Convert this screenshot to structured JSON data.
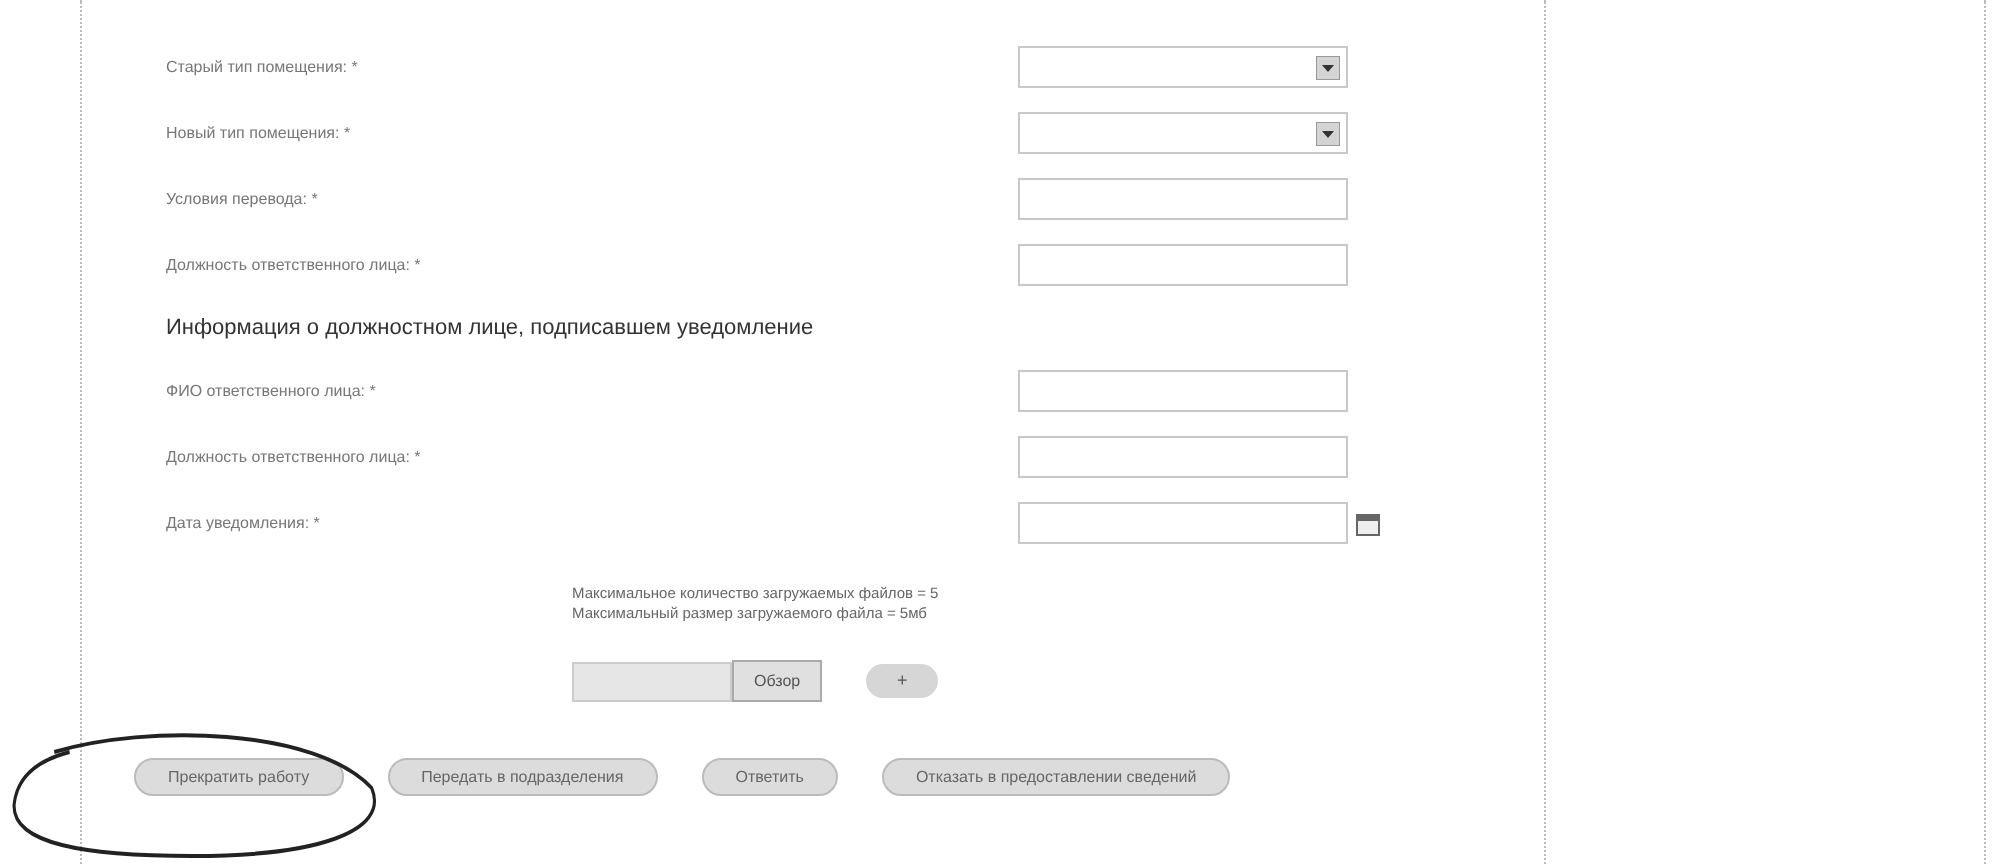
{
  "fields_top": [
    {
      "label": "Старый тип помещения: *",
      "kind": "select"
    },
    {
      "label": "Новый тип помещения: *",
      "kind": "select"
    },
    {
      "label": "Условия перевода: *",
      "kind": "text"
    },
    {
      "label": "Должность ответственного лица: *",
      "kind": "text"
    }
  ],
  "section_heading": "Информация о должностном лице, подписавшем уведомление",
  "fields_bottom": [
    {
      "label": "ФИО ответственного лица: *",
      "kind": "text"
    },
    {
      "label": "Должность ответственного лица: *",
      "kind": "text"
    },
    {
      "label": "Дата уведомления: *",
      "kind": "date"
    }
  ],
  "upload": {
    "limits": [
      "Максимальное количество загружаемых файлов = 5",
      "Максимальный размер загружаемого файла = 5мб"
    ],
    "browse_button": "Обзор",
    "add_button": "+"
  },
  "actions": [
    "Прекратить работу",
    "Передать в подразделения",
    "Ответить",
    "Отказать в предоставлении сведений"
  ]
}
